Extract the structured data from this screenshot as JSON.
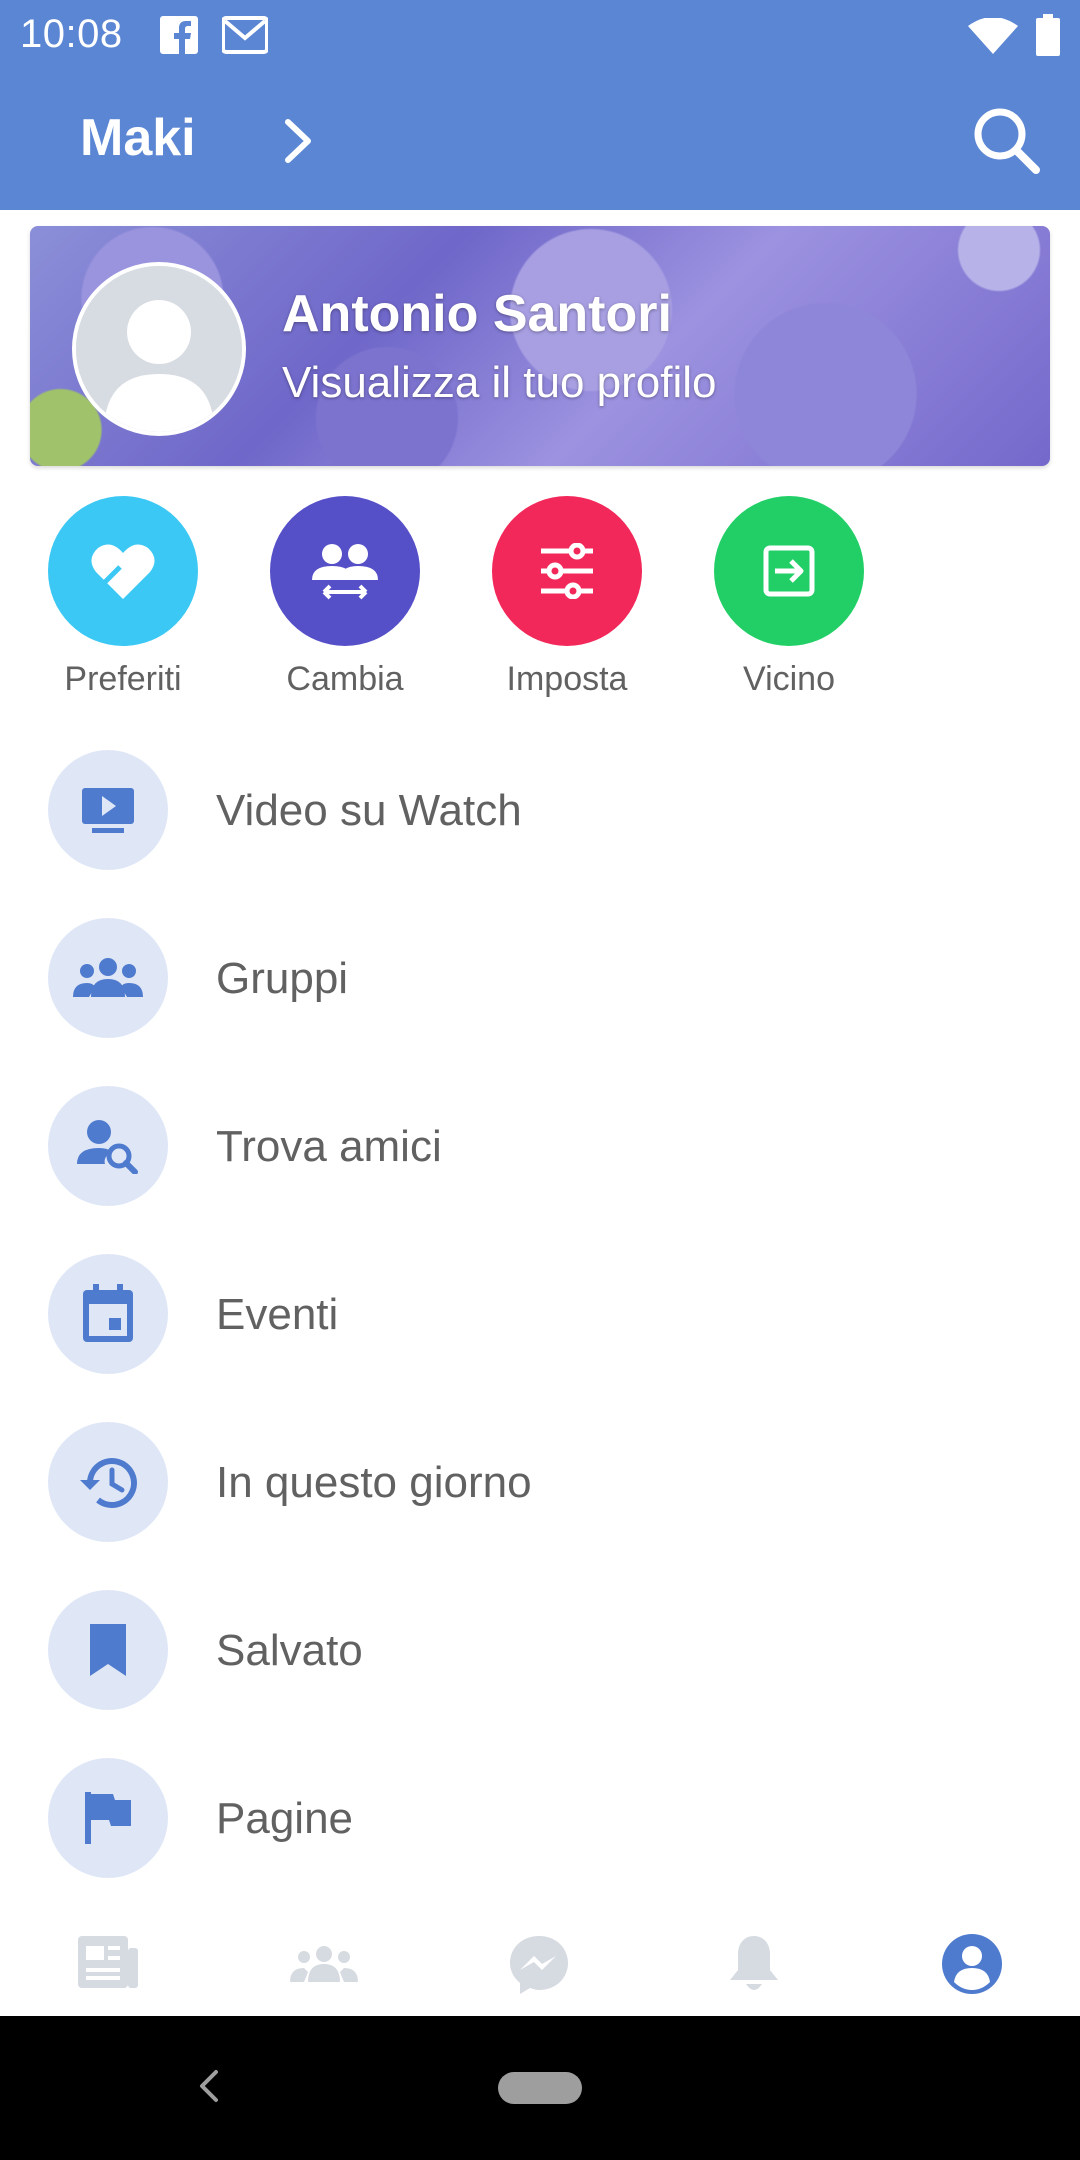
{
  "status_bar": {
    "time": "10:08"
  },
  "app_bar": {
    "title": "Maki"
  },
  "profile": {
    "name": "Antonio Santori",
    "subtitle": "Visualizza il tuo profilo"
  },
  "shortcuts": [
    {
      "label": "Preferiti",
      "color": "#3cc8f4",
      "icon": "heart-icon"
    },
    {
      "label": "Cambia",
      "color": "#5650c8",
      "icon": "switch-accounts-icon"
    },
    {
      "label": "Imposta",
      "color": "#f3285a",
      "icon": "sliders-icon"
    },
    {
      "label": "Vicino",
      "color": "#22cf67",
      "icon": "exit-icon"
    }
  ],
  "menu": [
    {
      "label": "Video su Watch",
      "icon": "video-icon"
    },
    {
      "label": "Gruppi",
      "icon": "groups-icon"
    },
    {
      "label": "Trova amici",
      "icon": "find-friends-icon"
    },
    {
      "label": "Eventi",
      "icon": "calendar-icon"
    },
    {
      "label": "In questo giorno",
      "icon": "history-icon"
    },
    {
      "label": "Salvato",
      "icon": "bookmark-icon"
    },
    {
      "label": "Pagine",
      "icon": "flag-icon"
    }
  ],
  "tabs": [
    {
      "icon": "news-feed-icon",
      "active": false
    },
    {
      "icon": "friends-icon",
      "active": false
    },
    {
      "icon": "messenger-icon",
      "active": false
    },
    {
      "icon": "bell-icon",
      "active": false
    },
    {
      "icon": "profile-icon",
      "active": true
    }
  ],
  "colors": {
    "primary": "#5b86d4",
    "icon_bg": "#dfe7f6",
    "icon_fg": "#4f7bcf",
    "inactive_tab": "#d6dae1",
    "text": "#616161"
  }
}
